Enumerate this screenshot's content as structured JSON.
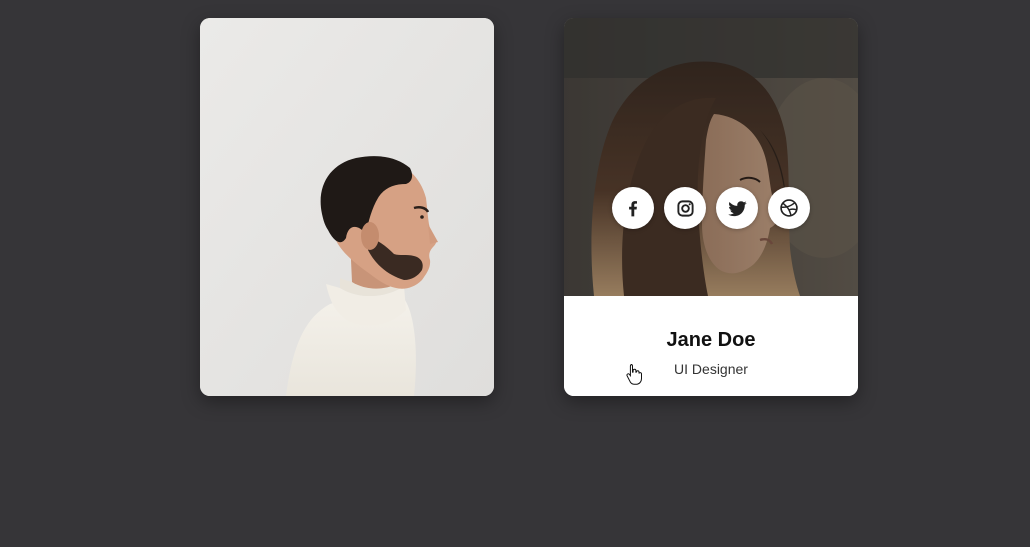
{
  "cards": [
    {
      "photo": "man-profile-photo"
    },
    {
      "photo": "woman-profile-photo",
      "name": "Jane Doe",
      "role": "UI Designer",
      "social": [
        {
          "icon": "facebook-icon"
        },
        {
          "icon": "instagram-icon"
        },
        {
          "icon": "twitter-icon"
        },
        {
          "icon": "dribbble-icon"
        }
      ]
    }
  ],
  "colors": {
    "background": "#363538",
    "card": "#ffffff",
    "icon": "#222222"
  }
}
